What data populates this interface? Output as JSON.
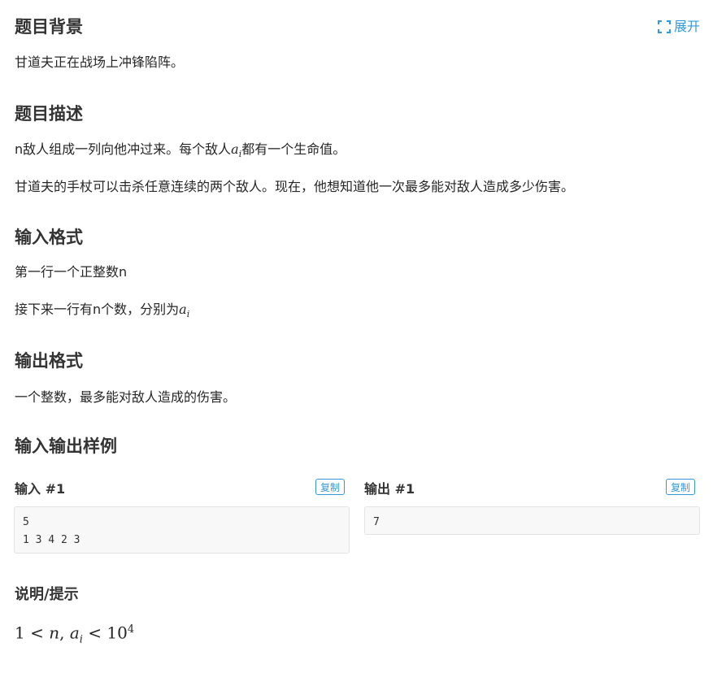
{
  "background": {
    "title": "题目背景",
    "expand_label": "展开",
    "text": "甘道夫正在战场上冲锋陷阵。"
  },
  "description": {
    "title": "题目描述",
    "line1_before": "n敌人组成一列向他冲过来。每个敌人",
    "line1_var": "a",
    "line1_sub": "i",
    "line1_after": "都有一个生命值。",
    "line2": "甘道夫的手杖可以击杀任意连续的两个敌人。现在，他想知道他一次最多能对敌人造成多少伤害。"
  },
  "input_format": {
    "title": "输入格式",
    "line1": "第一行一个正整数n",
    "line2_before": "接下来一行有n个数，分别为",
    "line2_var": "a",
    "line2_sub": "i"
  },
  "output_format": {
    "title": "输出格式",
    "line1": "一个整数，最多能对敌人造成的伤害。"
  },
  "samples": {
    "title": "输入输出样例",
    "input_title": "输入 #1",
    "output_title": "输出 #1",
    "copy_label": "复制",
    "input_value": "5\n1 3 4 2 3",
    "output_value": "7"
  },
  "hint": {
    "title": "说明/提示",
    "formula": {
      "one": "1",
      "lt1": "<",
      "n": "n",
      "comma": ",",
      "a": "a",
      "sub": "i",
      "lt2": "<",
      "ten": "10",
      "exp": "4"
    }
  },
  "colors": {
    "accent": "#3498db",
    "heading": "#333333",
    "code_bg": "#f8f8f8"
  }
}
